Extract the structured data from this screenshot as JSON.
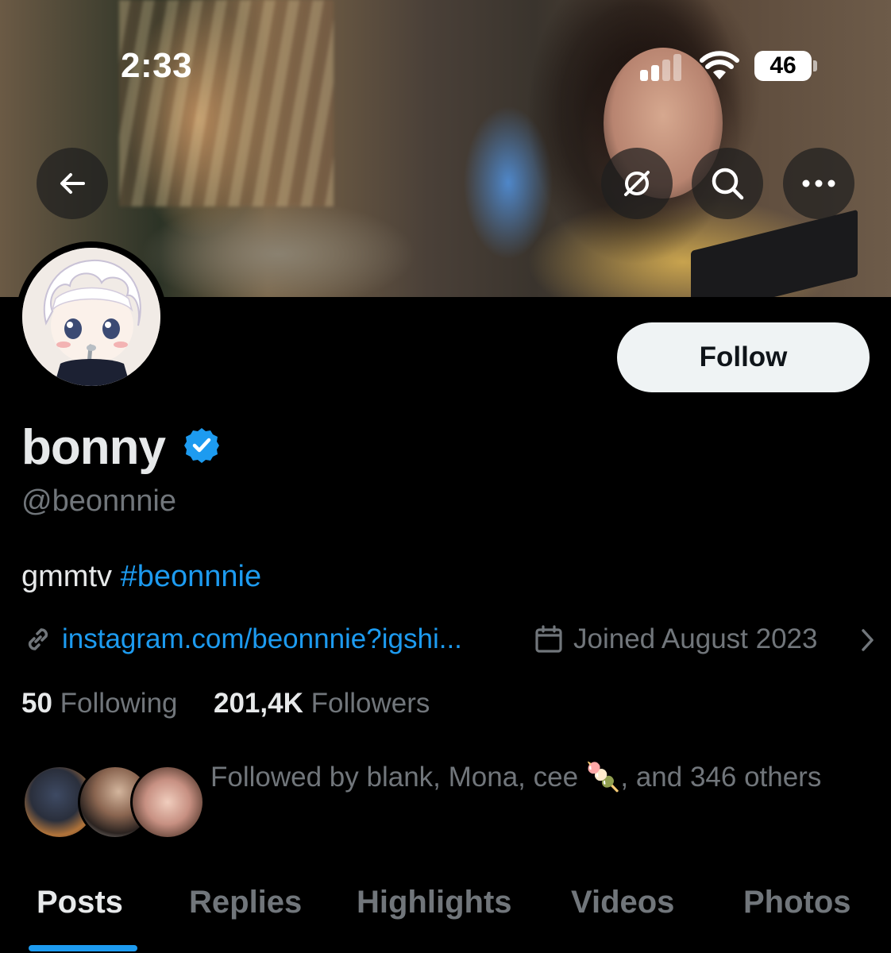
{
  "status_bar": {
    "time": "2:33",
    "battery": "46"
  },
  "header": {
    "back_icon": "arrow-left-icon",
    "grok_icon": "grok-icon",
    "search_icon": "search-icon",
    "more_icon": "more-horizontal-icon"
  },
  "profile": {
    "display_name": "bonny",
    "handle": "@beonnnie",
    "bio_text": "gmmtv",
    "bio_hashtag": "#beonnnie",
    "link": "instagram.com/beonnnie?igshi...",
    "joined": "Joined August 2023",
    "following_count": "50",
    "following_label": "Following",
    "followers_count": "201,4K",
    "followers_label": "Followers",
    "follow_button": "Follow",
    "followed_by_prefix": "Followed by blank, Mona, cee",
    "followed_by_emoji": "🍡",
    "followed_by_suffix": ", and 346 others"
  },
  "tabs": [
    {
      "label": "Posts",
      "active": true
    },
    {
      "label": "Replies",
      "active": false
    },
    {
      "label": "Highlights",
      "active": false
    },
    {
      "label": "Videos",
      "active": false
    },
    {
      "label": "Photos",
      "active": false
    }
  ],
  "colors": {
    "accent": "#1d9bf0",
    "background": "#000000",
    "muted_text": "#71767b",
    "primary_text": "#e7e9ea"
  }
}
